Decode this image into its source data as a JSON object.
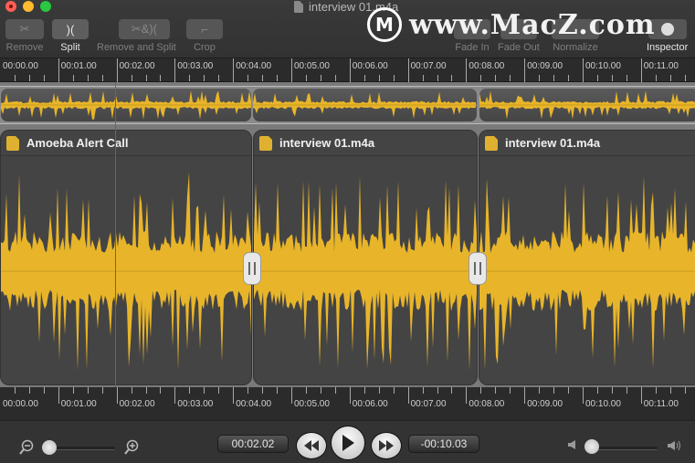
{
  "window": {
    "title": "interview 01.m4a",
    "controls": [
      "close",
      "minimize",
      "zoom"
    ]
  },
  "toolbar": {
    "tools": [
      {
        "id": "remove",
        "label": "Remove",
        "icon": "scissors-icon",
        "glyph": "✂",
        "enabled": false
      },
      {
        "id": "split",
        "label": "Split",
        "icon": "split-icon",
        "glyph": ")(",
        "enabled": true
      },
      {
        "id": "remove-and-split",
        "label": "Remove and Split",
        "icon": "remove-split-icon",
        "glyph": "✂&)(",
        "enabled": false
      },
      {
        "id": "crop",
        "label": "Crop",
        "icon": "crop-icon",
        "glyph": "⌗",
        "enabled": false
      },
      {
        "id": "fade-in",
        "label": "Fade In",
        "icon": "fade-in-icon",
        "enabled": false
      },
      {
        "id": "fade-out",
        "label": "Fade Out",
        "icon": "fade-out-icon",
        "enabled": false
      },
      {
        "id": "normalize",
        "label": "Normalize",
        "icon": "normalize-icon",
        "enabled": false
      },
      {
        "id": "inspector",
        "label": "Inspector",
        "icon": "info-icon",
        "enabled": true
      }
    ]
  },
  "watermark": {
    "text": "www.MacZ.com",
    "logo": "M"
  },
  "ruler": {
    "labels": [
      "00:00.00",
      "00:01.00",
      "00:02.00",
      "00:03.00",
      "00:04.00",
      "00:05.00",
      "00:06.00",
      "00:07.00",
      "00:08.00",
      "00:09.00",
      "00:10.00",
      "00:11.00"
    ]
  },
  "clips": [
    {
      "title": "Amoeba Alert Call",
      "icon": "aac-file-icon"
    },
    {
      "title": "interview 01.m4a",
      "icon": "aac-file-icon"
    },
    {
      "title": "interview 01.m4a",
      "icon": "aac-file-icon"
    }
  ],
  "colors": {
    "waveform": "#e8b52a",
    "playhead": "#d83a20"
  },
  "transport": {
    "current_time": "00:02.02",
    "remaining_time": "-00:10.03",
    "zoom_level": 0.0,
    "volume_level": 0.0,
    "rewind_label": "rewind",
    "play_label": "play",
    "forward_label": "fast-forward"
  }
}
